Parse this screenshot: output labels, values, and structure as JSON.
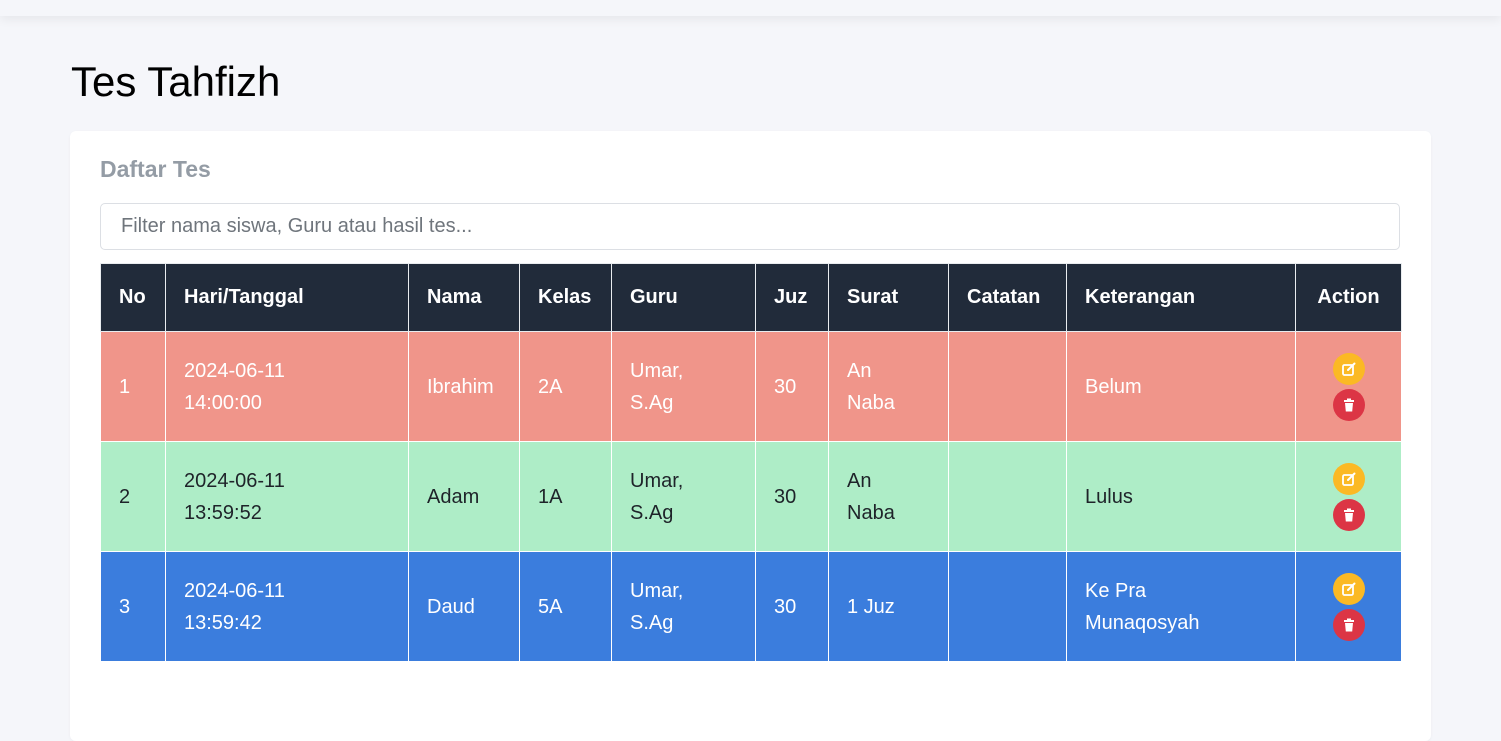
{
  "page": {
    "title": "Tes Tahfizh"
  },
  "card": {
    "title": "Daftar Tes",
    "filter_placeholder": "Filter nama siswa, Guru atau hasil tes..."
  },
  "table": {
    "headers": [
      "No",
      "Hari/Tanggal",
      "Nama",
      "Kelas",
      "Guru",
      "Juz",
      "Surat",
      "Catatan",
      "Keterangan",
      "Action"
    ],
    "rows": [
      {
        "no": "1",
        "date": "2024-06-11",
        "time": "14:00:00",
        "nama": "Ibrahim",
        "kelas": "2A",
        "guru_line1": "Umar,",
        "guru_line2": "S.Ag",
        "juz": "30",
        "surat_line1": "An",
        "surat_line2": "Naba",
        "catatan": "",
        "keterangan_line1": "Belum",
        "keterangan_line2": "",
        "row_color": "#f0958a"
      },
      {
        "no": "2",
        "date": "2024-06-11",
        "time": "13:59:52",
        "nama": "Adam",
        "kelas": "1A",
        "guru_line1": "Umar,",
        "guru_line2": "S.Ag",
        "juz": "30",
        "surat_line1": "An",
        "surat_line2": "Naba",
        "catatan": "",
        "keterangan_line1": "Lulus",
        "keterangan_line2": "",
        "row_color": "#aeedc7"
      },
      {
        "no": "3",
        "date": "2024-06-11",
        "time": "13:59:42",
        "nama": "Daud",
        "kelas": "5A",
        "guru_line1": "Umar,",
        "guru_line2": "S.Ag",
        "juz": "30",
        "surat_line1": "1 Juz",
        "surat_line2": "",
        "catatan": "",
        "keterangan_line1": "Ke Pra",
        "keterangan_line2": "Munaqosyah",
        "row_color": "#3b7ddd"
      }
    ]
  },
  "icons": {
    "edit": "edit-icon",
    "delete": "trash-icon"
  },
  "colors": {
    "header_bg": "#212b3a",
    "edit_button": "#fbb924",
    "delete_button": "#dc3545"
  }
}
